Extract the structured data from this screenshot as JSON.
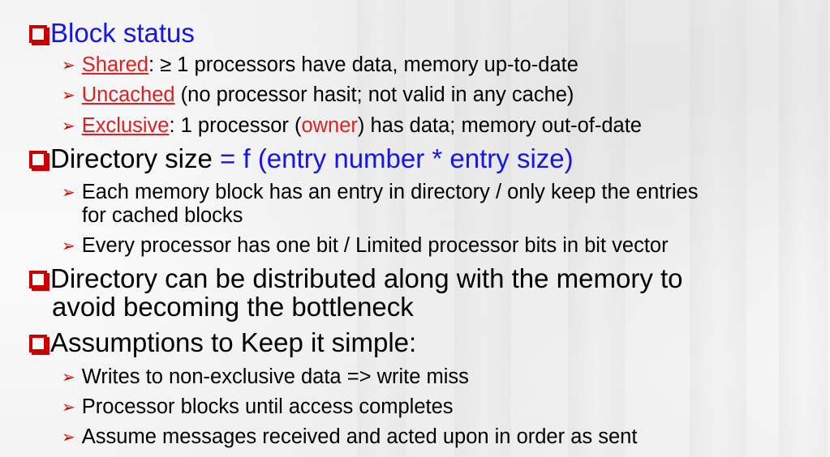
{
  "bullets": {
    "b1": {
      "text": "Block status"
    },
    "b1s1": {
      "term": "Shared",
      "rest": ": ≥ 1 processors have data, memory up-to-date"
    },
    "b1s2": {
      "term": "Uncached",
      "rest": " (no processor hasit; not valid in any cache)"
    },
    "b1s3": {
      "term": "Exclusive",
      "mid": ": 1 processor (",
      "owner": "owner",
      "rest": ") has data; memory out-of-date"
    },
    "b2": {
      "text": "Directory size",
      "formula": " = f (entry number * entry size)"
    },
    "b2s1": {
      "line1": "Each memory block has an entry in directory / only keep the entries",
      "line2": "for cached blocks"
    },
    "b2s2": {
      "text": "Every processor has one bit / Limited processor bits in bit vector"
    },
    "b3": {
      "line1": "Directory can be distributed along with the memory to",
      "line2": "avoid becoming the bottleneck"
    },
    "b4": {
      "text": "Assumptions to Keep it simple:"
    },
    "b4s1": {
      "text": "Writes to non-exclusive data  => write miss"
    },
    "b4s2": {
      "text": "Processor blocks until access completes"
    },
    "b4s3": {
      "text": "Assume messages received and acted upon in order as sent"
    }
  },
  "icons": {
    "level1": "hollow-square-bullet-icon",
    "level2": "arrowhead-bullet-icon"
  },
  "colors": {
    "bullet": "#cc0000",
    "heading": "#1515e6",
    "term": "#e02020"
  }
}
